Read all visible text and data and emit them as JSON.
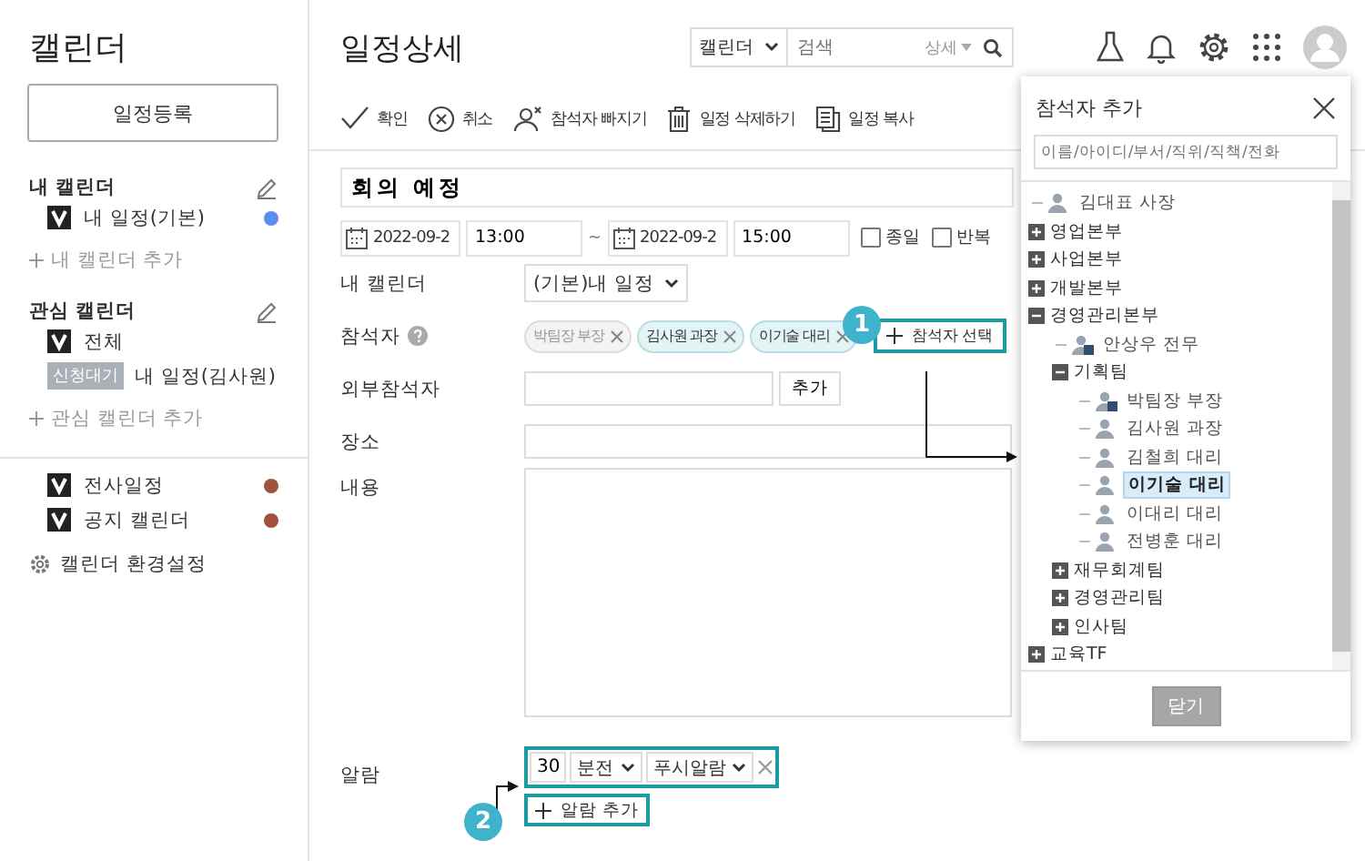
{
  "sidebar": {
    "title": "캘린더",
    "register_button": "일정등록",
    "sections": [
      {
        "title": "내 캘린더",
        "editable": true,
        "items": [
          {
            "kind": "calendar",
            "label": "내 일정(기본)",
            "checked": true,
            "color": "#5b8def"
          }
        ],
        "add_link": "내 캘린더 추가"
      },
      {
        "title": "관심 캘린더",
        "editable": true,
        "items": [
          {
            "kind": "calendar",
            "label": "전체",
            "checked": true
          },
          {
            "kind": "pending",
            "badge": "신청대기",
            "label": "내 일정(김사원)"
          }
        ],
        "add_link": "관심 캘린더 추가"
      }
    ],
    "shared_items": [
      {
        "label": "전사일정",
        "checked": true,
        "color": "#a0523d"
      },
      {
        "label": "공지 캘린더",
        "checked": true,
        "color": "#a0523d"
      }
    ],
    "settings_link": "캘린더 환경설정"
  },
  "header": {
    "title": "일정상세",
    "search": {
      "scope": "캘린더",
      "placeholder": "검색",
      "detail": "상세"
    }
  },
  "toolbar": [
    {
      "label": "확인"
    },
    {
      "label": "취소"
    },
    {
      "label": "참석자 빠지기"
    },
    {
      "label": "일정 삭제하기"
    },
    {
      "label": "일정 복사"
    }
  ],
  "form": {
    "title": "회의 예정",
    "start_date": "2022-09-2",
    "start_time": "13:00",
    "separator": "~",
    "end_date": "2022-09-2",
    "end_time": "15:00",
    "options": [
      {
        "label": "종일",
        "checked": false
      },
      {
        "label": "반복",
        "checked": false
      }
    ],
    "calendar": {
      "label": "내 캘린더",
      "value": "(기본)내 일정"
    },
    "attendees": {
      "label": "참석자",
      "tags": [
        {
          "name": "박팀장 부장",
          "disabled": true
        },
        {
          "name": "김사원 과장",
          "disabled": false
        },
        {
          "name": "이기술 대리",
          "disabled": false
        }
      ],
      "select_button": "참석자 선택"
    },
    "external": {
      "label": "외부참석자",
      "add_button": "추가"
    },
    "place": {
      "label": "장소"
    },
    "content": {
      "label": "내용"
    },
    "alarm": {
      "label": "알람",
      "entries": [
        {
          "amount": "30",
          "unit": "분전",
          "type": "푸시알람"
        }
      ],
      "add_button": "알람 추가"
    }
  },
  "callouts": [
    {
      "number": "1"
    },
    {
      "number": "2"
    }
  ],
  "popup": {
    "title": "참석자 추가",
    "placeholder": "이름/아이디/부서/직위/직책/전화",
    "close_button": "닫기",
    "tree": [
      {
        "kind": "person",
        "label": "김대표 사장",
        "leader": false,
        "selected": false
      },
      {
        "kind": "dept",
        "label": "영업본부",
        "expanded": false
      },
      {
        "kind": "dept",
        "label": "사업본부",
        "expanded": false
      },
      {
        "kind": "dept",
        "label": "개발본부",
        "expanded": false
      },
      {
        "kind": "dept",
        "label": "경영관리본부",
        "expanded": true,
        "children": [
          {
            "kind": "person",
            "label": "안상우 전무",
            "leader": true,
            "selected": false
          },
          {
            "kind": "dept",
            "label": "기획팀",
            "expanded": true,
            "children": [
              {
                "kind": "person",
                "label": "박팀장 부장",
                "leader": true,
                "selected": false
              },
              {
                "kind": "person",
                "label": "김사원 과장",
                "leader": false,
                "selected": false
              },
              {
                "kind": "person",
                "label": "김철희 대리",
                "leader": false,
                "selected": false
              },
              {
                "kind": "person",
                "label": "이기술 대리",
                "leader": false,
                "selected": true
              },
              {
                "kind": "person",
                "label": "이대리 대리",
                "leader": false,
                "selected": false
              },
              {
                "kind": "person",
                "label": "전병훈 대리",
                "leader": false,
                "selected": false
              }
            ]
          },
          {
            "kind": "dept",
            "label": "재무회계팀",
            "expanded": false
          },
          {
            "kind": "dept",
            "label": "경영관리팀",
            "expanded": false
          },
          {
            "kind": "dept",
            "label": "인사팀",
            "expanded": false
          }
        ]
      },
      {
        "kind": "dept",
        "label": "교육TF",
        "expanded": false
      }
    ]
  }
}
